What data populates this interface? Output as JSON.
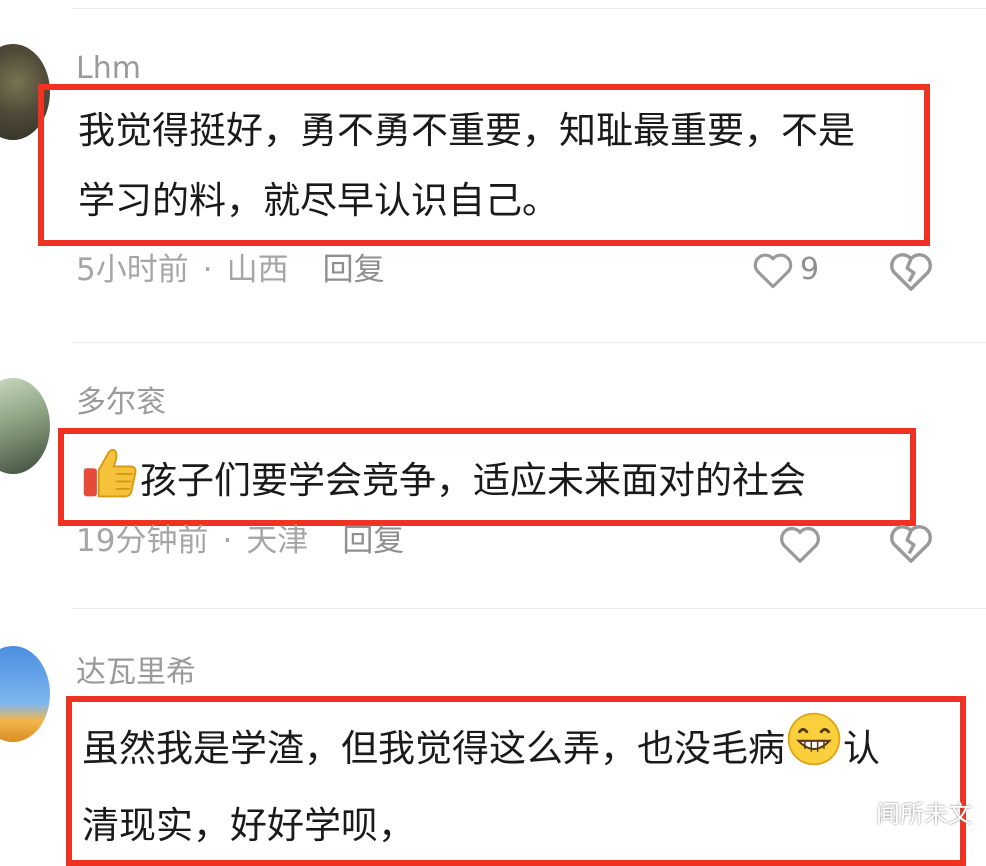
{
  "comments": [
    {
      "user": "Lhm",
      "lines": [
        "我觉得挺好，勇不勇不重要，知耻最重要，不是",
        "学习的料，就尽早认识自己。"
      ],
      "time": "5小时前",
      "location": "山西",
      "reply_label": "回复",
      "likes": "9"
    },
    {
      "user": "多尔衮",
      "emoji": "thumbs-up",
      "text": "孩子们要学会竞争，适应未来面对的社会",
      "time": "19分钟前",
      "location": "天津",
      "reply_label": "回复",
      "likes": ""
    },
    {
      "user": "达瓦里希",
      "line1": "虽然我是学渣，但我觉得这么弄，也没毛病",
      "emoji": "grinning-face",
      "line1_end": "认",
      "line2": "清现实，好好学呗，"
    }
  ],
  "separator": "·",
  "watermark": "闻所未文",
  "colors": {
    "highlight_border": "#ee3322",
    "meta_text": "#a6a6a6",
    "username": "#9a9a9a"
  }
}
